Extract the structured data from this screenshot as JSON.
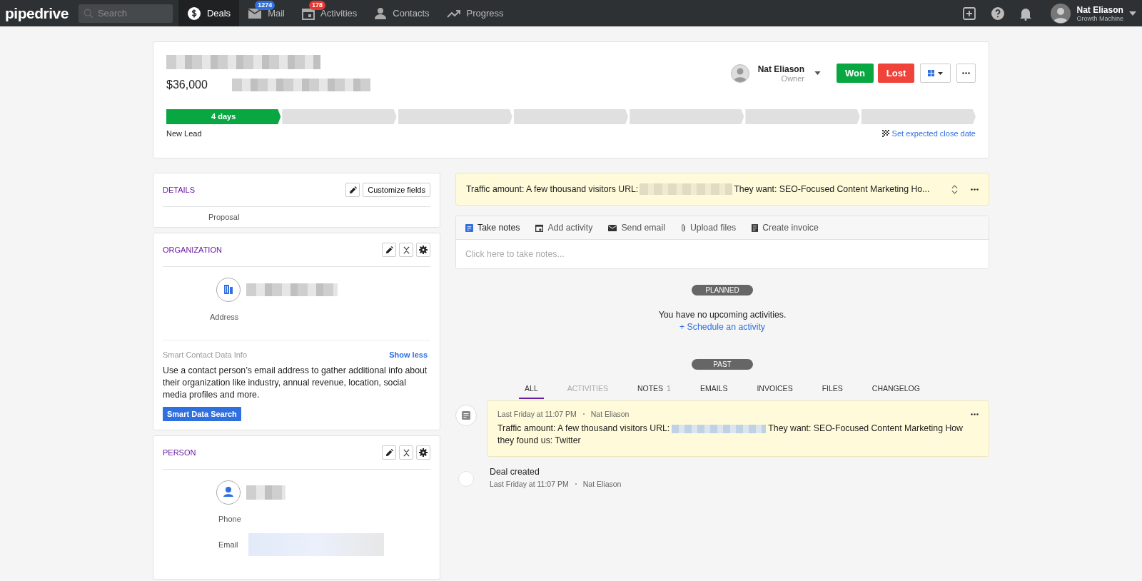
{
  "topbar": {
    "logo": "pipedrive",
    "search": {
      "placeholder": "Search"
    },
    "nav": [
      {
        "label": "Deals",
        "selected": true
      },
      {
        "label": "Mail",
        "badge": "1274",
        "color": "#2f6fde",
        "selected": false
      },
      {
        "label": "Activities",
        "badge": "178",
        "color": "#e8372f",
        "selected": false
      },
      {
        "label": "Contacts",
        "selected": false
      },
      {
        "label": "Progress",
        "selected": false
      }
    ],
    "user": {
      "name": "Nat Eliason",
      "company": "Growth Machine"
    }
  },
  "deal": {
    "value": "$36,000",
    "owner": {
      "name": "Nat Eliason",
      "role": "Owner"
    },
    "won": "Won",
    "lost": "Lost",
    "stages": [
      {
        "label": "4 days",
        "selected": true
      },
      {
        "selected": false
      },
      {
        "selected": false
      },
      {
        "selected": false
      },
      {
        "selected": false
      },
      {
        "selected": false
      },
      {
        "selected": false
      }
    ],
    "stage_name": "New Lead",
    "close_date_link": "Set expected close date"
  },
  "details": {
    "title": "DETAILS",
    "customize": "Customize fields",
    "value": "Proposal"
  },
  "organization": {
    "title": "ORGANIZATION",
    "field": "Address",
    "info_title": "Smart Contact Data Info",
    "show_less": "Show less",
    "info_text": "Use a contact person’s email address to gather additional info about their organization like industry, annual revenue, location, social media profiles and more.",
    "button": "Smart Data Search"
  },
  "person": {
    "title": "PERSON",
    "fields": [
      "Phone",
      "Email"
    ]
  },
  "pinned_note": "Traffic amount: A few thousand visitors URL:",
  "pinned_note_rest": "They want: SEO-Focused Content Marketing Ho...",
  "composer": {
    "tabs": [
      {
        "label": "Take notes",
        "selected": true
      },
      {
        "label": "Add activity",
        "selected": false
      },
      {
        "label": "Send email",
        "selected": false
      },
      {
        "label": "Upload files",
        "selected": false
      },
      {
        "label": "Create invoice",
        "selected": false
      }
    ],
    "placeholder": "Click here to take notes..."
  },
  "planned": {
    "label": "PLANNED",
    "empty": "You have no upcoming activities.",
    "link": "+ Schedule an activity"
  },
  "past": {
    "label": "PAST",
    "filters": [
      {
        "label": "ALL",
        "selected": true,
        "disabled": false
      },
      {
        "label": "ACTIVITIES",
        "selected": false,
        "disabled": true
      },
      {
        "label": "NOTES",
        "count": "1",
        "selected": false,
        "disabled": false
      },
      {
        "label": "EMAILS",
        "selected": false,
        "disabled": false
      },
      {
        "label": "INVOICES",
        "selected": false,
        "disabled": false
      },
      {
        "label": "FILES",
        "selected": false,
        "disabled": false
      },
      {
        "label": "CHANGELOG",
        "selected": false,
        "disabled": false
      }
    ]
  },
  "timeline": [
    {
      "kind": "note",
      "time": "Last Friday at 11:07 PM",
      "author": "Nat Eliason",
      "text": "Traffic amount: A few thousand visitors URL:",
      "text_rest": "They want: SEO-Focused Content Marketing How",
      "text_line2": "they found us: Twitter"
    },
    {
      "kind": "event",
      "title": "Deal created",
      "time": "Last Friday at 11:07 PM",
      "author": "Nat Eliason"
    }
  ]
}
